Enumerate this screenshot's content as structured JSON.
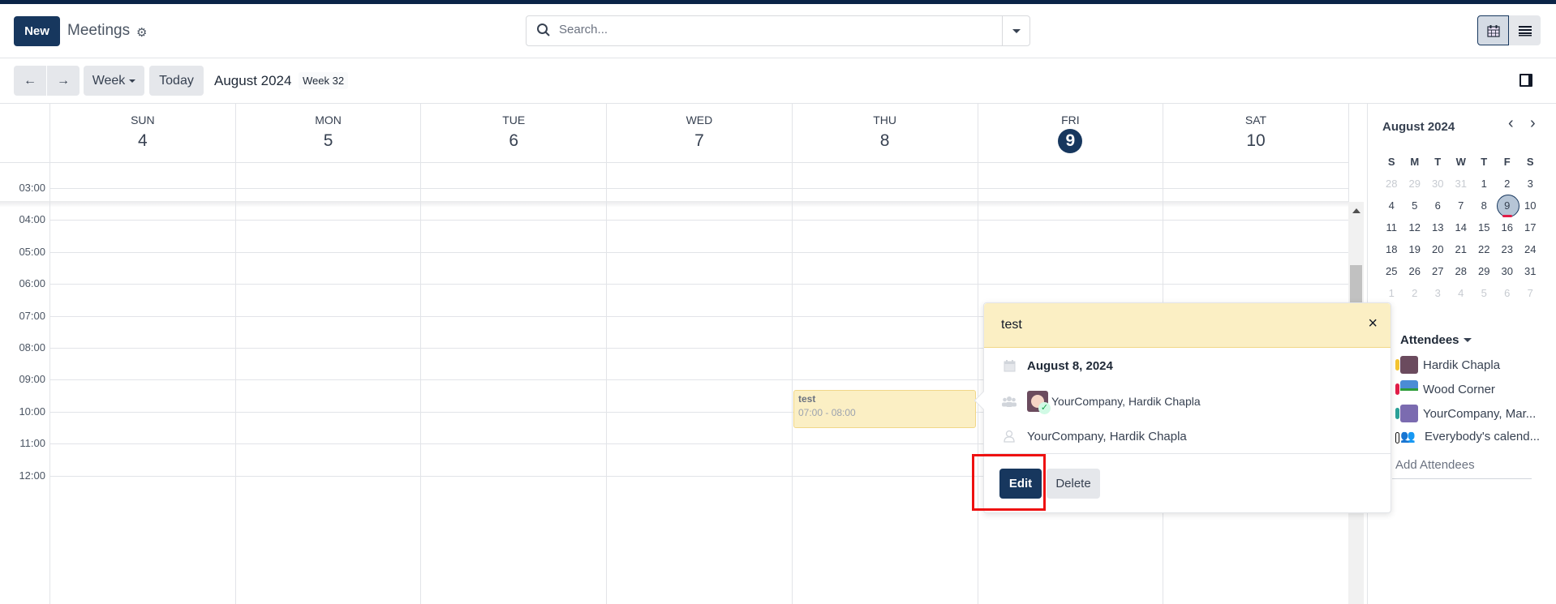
{
  "header": {
    "new_label": "New",
    "app_title": "Meetings",
    "search_placeholder": "Search...",
    "views": [
      {
        "name": "calendar",
        "icon": "calendar-icon",
        "active": true
      },
      {
        "name": "list",
        "icon": "list-icon",
        "active": false
      }
    ]
  },
  "toolbar": {
    "prev_icon": "←",
    "next_icon": "→",
    "scale_label": "Week",
    "today_label": "Today",
    "range_title": "August 2024",
    "week_badge": "Week 32"
  },
  "calendar": {
    "days": [
      {
        "name": "SUN",
        "num": "4",
        "today": false
      },
      {
        "name": "MON",
        "num": "5",
        "today": false
      },
      {
        "name": "TUE",
        "num": "6",
        "today": false
      },
      {
        "name": "WED",
        "num": "7",
        "today": false
      },
      {
        "name": "THU",
        "num": "8",
        "today": false
      },
      {
        "name": "FRI",
        "num": "9",
        "today": true
      },
      {
        "name": "SAT",
        "num": "10",
        "today": false
      }
    ],
    "hours": [
      "03:00",
      "04:00",
      "05:00",
      "06:00",
      "07:00",
      "08:00",
      "09:00",
      "10:00",
      "11:00",
      "12:00"
    ],
    "events": [
      {
        "title": "test",
        "time": "07:00 - 08:00",
        "day": "THU"
      }
    ]
  },
  "popover": {
    "title": "test",
    "close_icon": "×",
    "date": "August 8, 2024",
    "attendees": "YourCompany, Hardik Chapla",
    "organizer": "YourCompany, Hardik Chapla",
    "edit_label": "Edit",
    "delete_label": "Delete"
  },
  "sidebar": {
    "month_title": "August 2024",
    "prev_icon": "‹",
    "next_icon": "›",
    "weekday_headers": [
      "S",
      "M",
      "T",
      "W",
      "T",
      "F",
      "S"
    ],
    "weeks": [
      [
        {
          "d": "28",
          "m": true
        },
        {
          "d": "29",
          "m": true
        },
        {
          "d": "30",
          "m": true
        },
        {
          "d": "31",
          "m": true
        },
        {
          "d": "1"
        },
        {
          "d": "2"
        },
        {
          "d": "3"
        }
      ],
      [
        {
          "d": "4"
        },
        {
          "d": "5"
        },
        {
          "d": "6"
        },
        {
          "d": "7"
        },
        {
          "d": "8"
        },
        {
          "d": "9",
          "sel": true
        },
        {
          "d": "10"
        }
      ],
      [
        {
          "d": "11"
        },
        {
          "d": "12"
        },
        {
          "d": "13"
        },
        {
          "d": "14"
        },
        {
          "d": "15"
        },
        {
          "d": "16"
        },
        {
          "d": "17"
        }
      ],
      [
        {
          "d": "18"
        },
        {
          "d": "19"
        },
        {
          "d": "20"
        },
        {
          "d": "21"
        },
        {
          "d": "22"
        },
        {
          "d": "23"
        },
        {
          "d": "24"
        }
      ],
      [
        {
          "d": "25"
        },
        {
          "d": "26"
        },
        {
          "d": "27"
        },
        {
          "d": "28"
        },
        {
          "d": "29"
        },
        {
          "d": "30"
        },
        {
          "d": "31"
        }
      ],
      [
        {
          "d": "1",
          "m": true
        },
        {
          "d": "2",
          "m": true
        },
        {
          "d": "3",
          "m": true
        },
        {
          "d": "4",
          "m": true
        },
        {
          "d": "5",
          "m": true
        },
        {
          "d": "6",
          "m": true
        },
        {
          "d": "7",
          "m": true
        }
      ]
    ],
    "attendees_label": "Attendees",
    "attendees": [
      {
        "name": "Hardik Chapla",
        "color": "#f4c430"
      },
      {
        "name": "Wood Corner",
        "color": "#e11d48"
      },
      {
        "name": "YourCompany, Mar...",
        "color": "#2aa198"
      },
      {
        "name": "Everybody's calend...",
        "color": "#ffffff"
      }
    ],
    "add_attendees_label": "Add Attendees"
  },
  "colors": {
    "brand": "#17375e",
    "event_bg": "#fbefc4",
    "highlight": "#ee1111"
  }
}
